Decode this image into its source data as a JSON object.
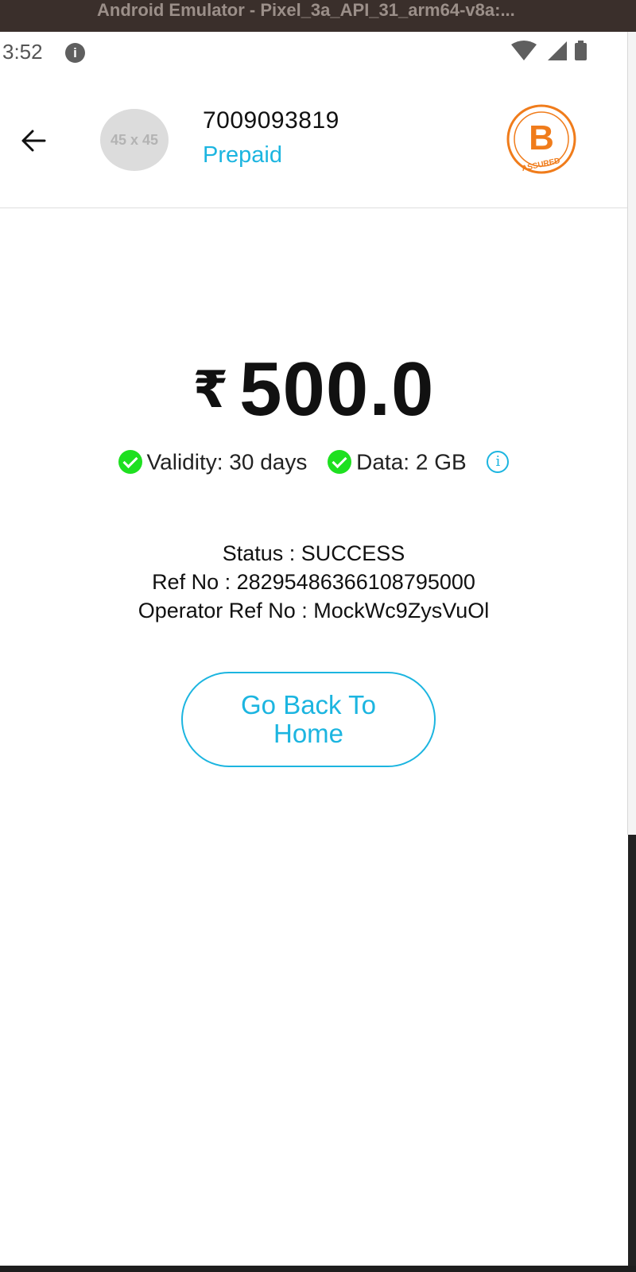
{
  "window": {
    "title": "Android Emulator - Pixel_3a_API_31_arm64-v8a:..."
  },
  "status_bar": {
    "time": "3:52",
    "info_icon_glyph": "i",
    "icons": [
      "wifi-icon",
      "cellular-signal-icon",
      "battery-icon"
    ]
  },
  "header": {
    "avatar_placeholder": "45 x 45",
    "phone_number": "7009093819",
    "plan_type": "Prepaid",
    "logo": {
      "letter": "B",
      "text": "ASSURED",
      "color": "#f07c1b"
    }
  },
  "amount": {
    "currency": "₹",
    "value": "500.0"
  },
  "benefits": [
    {
      "label": "Validity: 30 days"
    },
    {
      "label": "Data: 2 GB"
    }
  ],
  "info_glyph": "i",
  "transaction": {
    "status": "Status : SUCCESS",
    "ref_no": "Ref No : 2829548636610879500​0",
    "operator_ref_no": "Operator Ref No : MockWc9ZysVuOl"
  },
  "actions": {
    "home_button": "Go Back To Home"
  },
  "colors": {
    "accent": "#1cb5e0",
    "success": "#1ee020",
    "brand_orange": "#f07c1b"
  }
}
